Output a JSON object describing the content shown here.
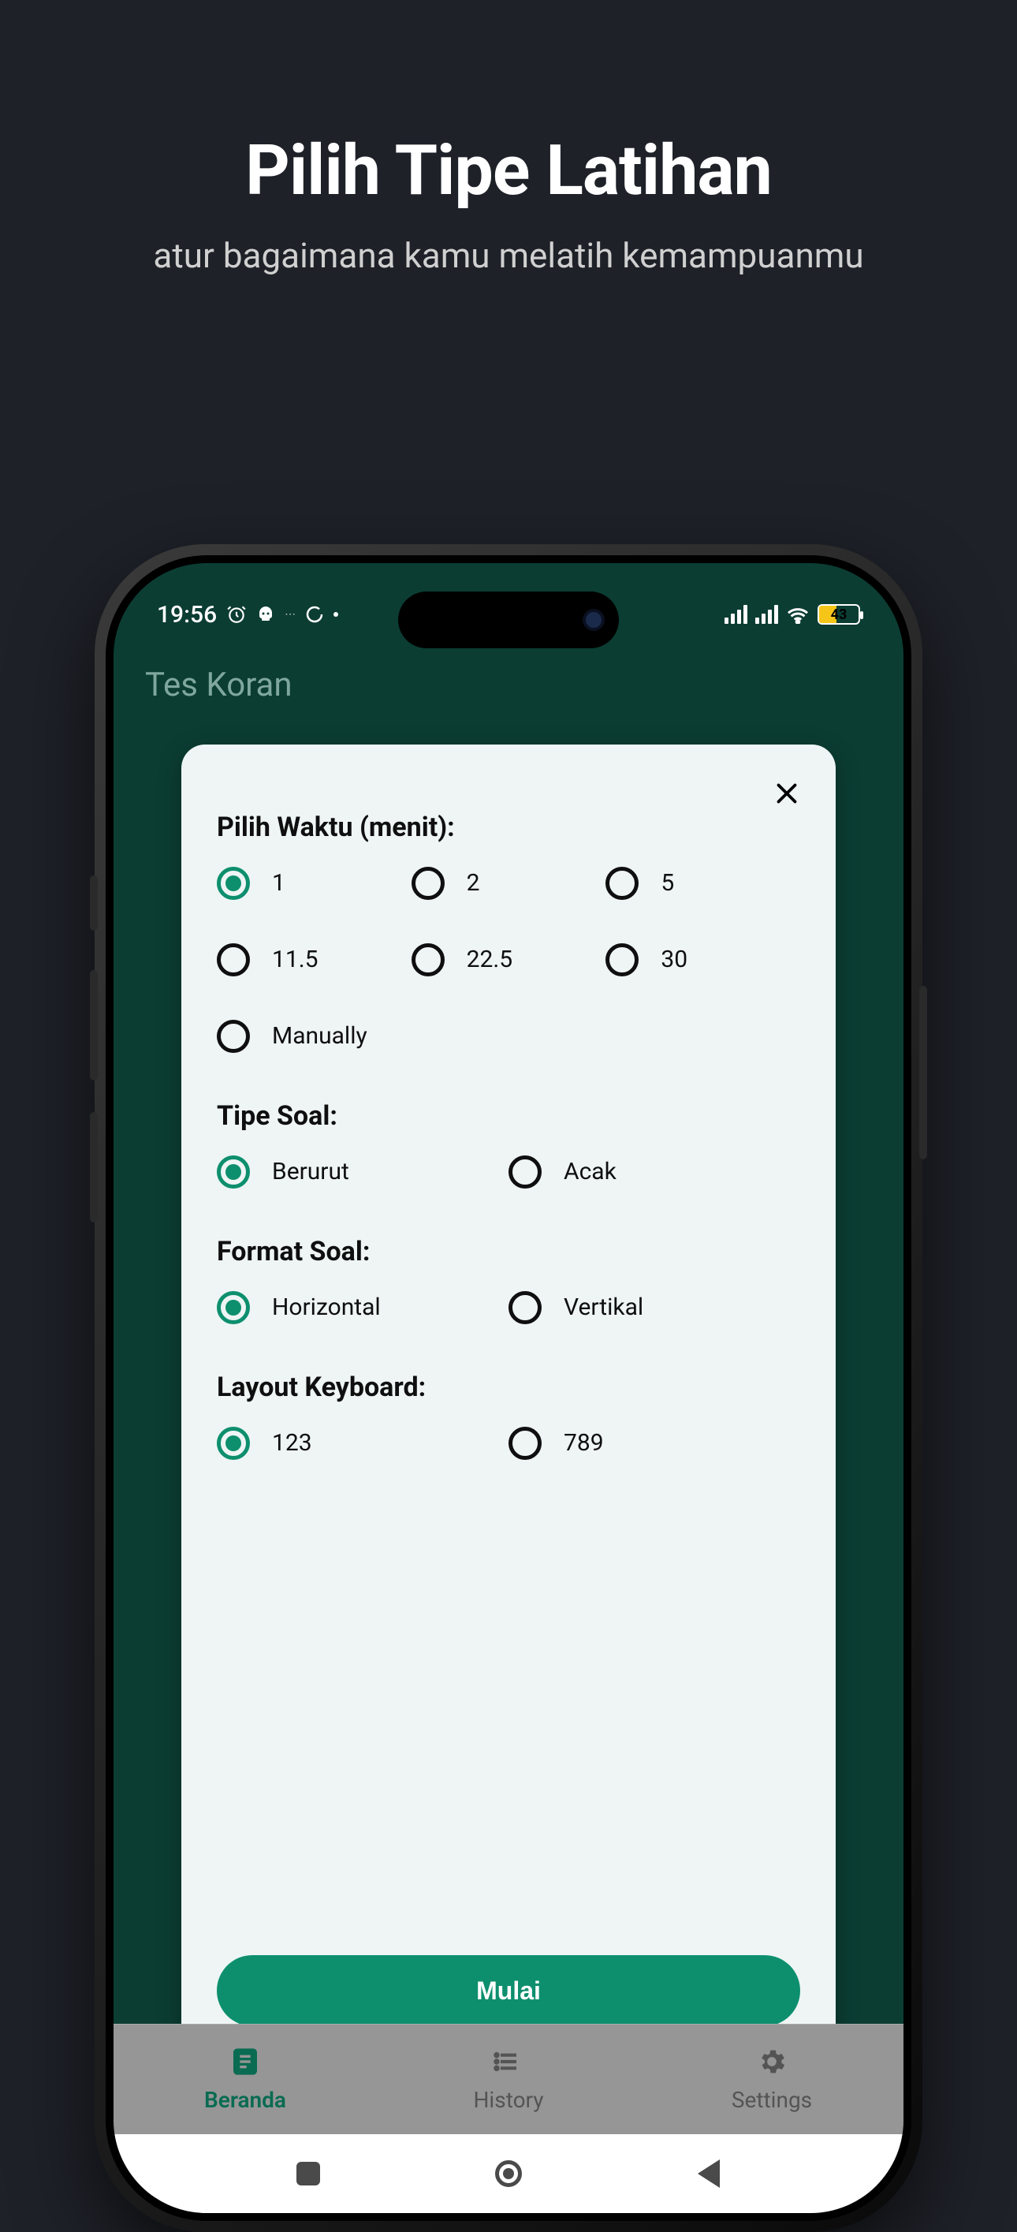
{
  "promo": {
    "title": "Pilih Tipe Latihan",
    "subtitle": "atur bagaimana kamu melatih kemampuanmu"
  },
  "statusbar": {
    "time": "19:56",
    "battery_pct": "43"
  },
  "app": {
    "title": "Tes Koran"
  },
  "card": {
    "sections": {
      "waktu": {
        "title": "Pilih Waktu (menit):",
        "options": [
          "1",
          "2",
          "5",
          "11.5",
          "22.5",
          "30",
          "Manually"
        ],
        "selected": 0
      },
      "tipe": {
        "title": "Tipe Soal:",
        "options": [
          "Berurut",
          "Acak"
        ],
        "selected": 0
      },
      "format": {
        "title": "Format Soal:",
        "options": [
          "Horizontal",
          "Vertikal"
        ],
        "selected": 0
      },
      "keyboard": {
        "title": "Layout Keyboard:",
        "options": [
          "123",
          "789"
        ],
        "selected": 0
      }
    },
    "start": "Mulai"
  },
  "tabs": {
    "items": [
      "Beranda",
      "History",
      "Settings"
    ],
    "active": 0
  }
}
